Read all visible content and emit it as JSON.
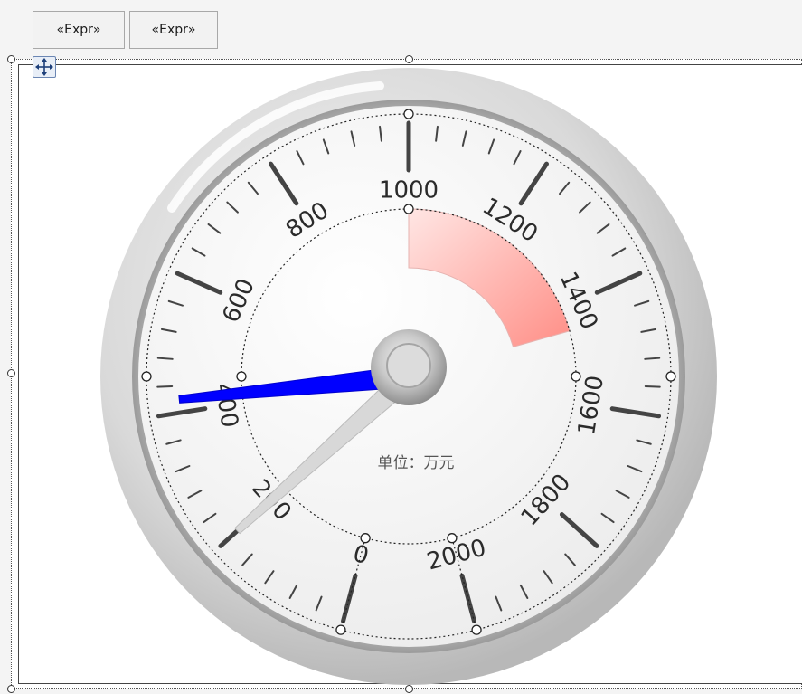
{
  "toolbar": {
    "buttons": [
      {
        "label": "«Expr»"
      },
      {
        "label": "«Expr»"
      }
    ]
  },
  "gauge": {
    "unit_label": "单位：万元",
    "scale_min": 0,
    "scale_max": 2000,
    "major_step": 200,
    "minor_per_major": 4,
    "tick_labels": [
      "0",
      "200",
      "400",
      "600",
      "800",
      "1000",
      "1200",
      "1400",
      "1600",
      "1800",
      "2000"
    ],
    "needle_values": [
      {
        "name": "needle-primary",
        "value": 420,
        "color": "#0000ff"
      },
      {
        "name": "needle-secondary",
        "value": 200,
        "color": "#d8d8d8"
      }
    ],
    "range_band": {
      "from": 1000,
      "to": 1450,
      "color": "#ff8a80"
    },
    "colors": {
      "bezel": "#c9c9c9",
      "face": "#f6f6f6",
      "ticks": "#444444"
    }
  }
}
